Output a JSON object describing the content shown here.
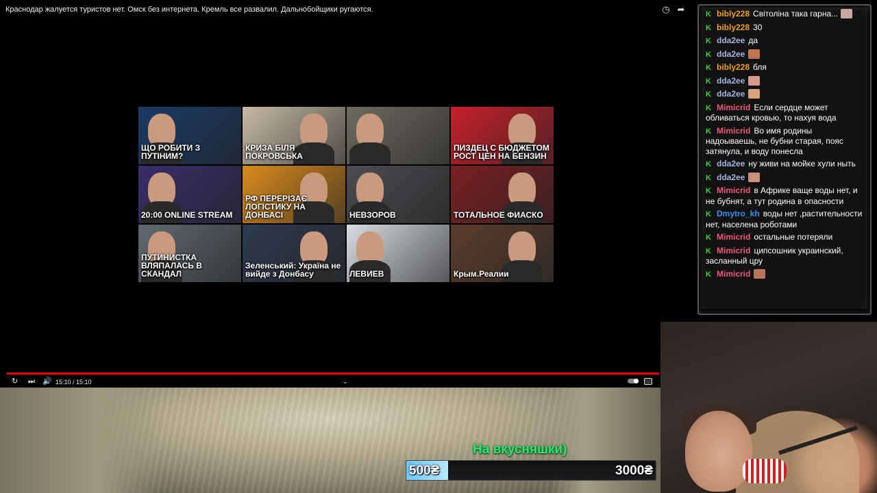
{
  "video": {
    "title": "Краснодар жалуется туристов нет. Омск без интернета. Кремль все развалил. Дальнобойщики ругаются.",
    "time": "15:10 / 15:10",
    "progress": 1.0
  },
  "thumbnails": [
    {
      "caption": "ЩО РОБИТИ З ПУТІНИМ?",
      "bg": "#1a3a66"
    },
    {
      "caption": "КРИЗА БІЛЯ ПОКРОВСЬКА",
      "bg": "#c7b9a4"
    },
    {
      "caption": "",
      "bg": "#6e6b5e"
    },
    {
      "caption": "ПИЗДЕЦ С БЮДЖЕТОМ РОСТ ЦЕН НА БЕНЗИН",
      "bg": "#c8202a"
    },
    {
      "caption": "20:00 ONLINE STREAM",
      "bg": "#3a2d6a"
    },
    {
      "caption": "РФ ПЕРЕРІЗАЄ ЛОГІСТИКУ НА ДОНБАСІ",
      "bg": "#d98b1c"
    },
    {
      "caption": "НЕВЗОРОВ",
      "bg": "#4a4c50"
    },
    {
      "caption": "ТОТАЛЬНОЕ ФИАСКО",
      "bg": "#7a1f22"
    },
    {
      "caption": "ПУТИНИСТКА ВЛЯПАЛАСЬ В СКАНДАЛ",
      "bg": "#5f6a72"
    },
    {
      "caption": "Зеленський: Україна не вийде з Донбасу",
      "bg": "#2d3a50"
    },
    {
      "caption": "ЛЕВИЕВ",
      "bg": "#d9dde3"
    },
    {
      "caption": "Крым.Реалии",
      "bg": "#5a3d2c"
    }
  ],
  "donation": {
    "label": "На вкусняшки)",
    "current": "500₴",
    "goal": "3000₴",
    "fraction": 0.1667
  },
  "chat": {
    "messages": [
      {
        "user": "bibly228",
        "color": "#f0a020",
        "text": "Світоліна така гарна...",
        "emote": "#c7a7a0"
      },
      {
        "user": "bibly228",
        "color": "#f0a020",
        "text": "30"
      },
      {
        "user": "dda2ee",
        "color": "#9fb6e0",
        "text": "да"
      },
      {
        "user": "dda2ee",
        "color": "#9fb6e0",
        "text": "",
        "emote": "#c0744f"
      },
      {
        "user": "bibly228",
        "color": "#f0a020",
        "text": "бля"
      },
      {
        "user": "dda2ee",
        "color": "#9fb6e0",
        "text": "",
        "emote": "#d59a8c"
      },
      {
        "user": "dda2ee",
        "color": "#9fb6e0",
        "text": "",
        "emote": "#d6a37e"
      },
      {
        "user": "Mimicrid",
        "color": "#ec5a78",
        "text": "Если сердце может обливаться кровью, то нахуя вода"
      },
      {
        "user": "Mimicrid",
        "color": "#ec5a78",
        "text": "Во имя родины надоываешь, не бубни старая, пояс затянула, и воду понесла"
      },
      {
        "user": "dda2ee",
        "color": "#9fb6e0",
        "text": "ну живи на мойке хули ныть"
      },
      {
        "user": "dda2ee",
        "color": "#9fb6e0",
        "text": "",
        "emote": "#c9917a"
      },
      {
        "user": "Mimicrid",
        "color": "#ec5a78",
        "text": "в Африке ваще воды нет, и не бубнят, а тут родина в опасности"
      },
      {
        "user": "Dmytro_kh",
        "color": "#3a8ef0",
        "text": "воды нет ,растительности нет, населена роботами"
      },
      {
        "user": "Mimicrid",
        "color": "#ec5a78",
        "text": "остальные потеряли"
      },
      {
        "user": "Mimicrid",
        "color": "#ec5a78",
        "text": "ципсошник украинский, засланный цру"
      },
      {
        "user": "Mimicrid",
        "color": "#ec5a78",
        "text": "",
        "emote": "#b9735a"
      }
    ]
  }
}
